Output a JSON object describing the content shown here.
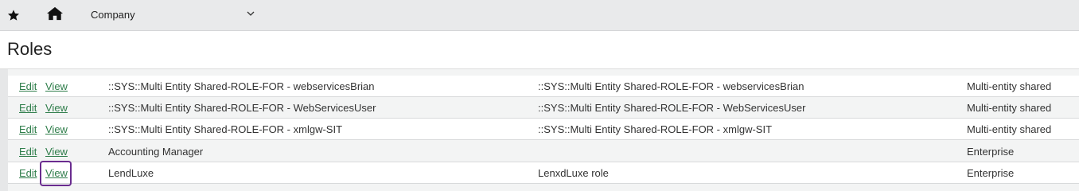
{
  "topbar": {
    "company_label": "Company"
  },
  "page": {
    "title": "Roles"
  },
  "table": {
    "rows": [
      {
        "edit": "Edit",
        "view": "View",
        "name": "::SYS::Multi Entity Shared-ROLE-FOR - webservicesBrian",
        "description": "::SYS::Multi Entity Shared-ROLE-FOR - webservicesBrian",
        "type": "Multi-entity shared"
      },
      {
        "edit": "Edit",
        "view": "View",
        "name": "::SYS::Multi Entity Shared-ROLE-FOR - WebServicesUser",
        "description": "::SYS::Multi Entity Shared-ROLE-FOR - WebServicesUser",
        "type": "Multi-entity shared"
      },
      {
        "edit": "Edit",
        "view": "View",
        "name": "::SYS::Multi Entity Shared-ROLE-FOR - xmlgw-SIT",
        "description": "::SYS::Multi Entity Shared-ROLE-FOR - xmlgw-SIT",
        "type": "Multi-entity shared"
      },
      {
        "edit": "Edit",
        "view": "View",
        "name": "Accounting Manager",
        "description": "",
        "type": "Enterprise"
      },
      {
        "edit": "Edit",
        "view": "View",
        "name": "LendLuxe",
        "description": "LenxdLuxe role",
        "type": "Enterprise"
      }
    ]
  },
  "colors": {
    "link": "#2e7d4a",
    "highlight": "#6a2c8f"
  }
}
